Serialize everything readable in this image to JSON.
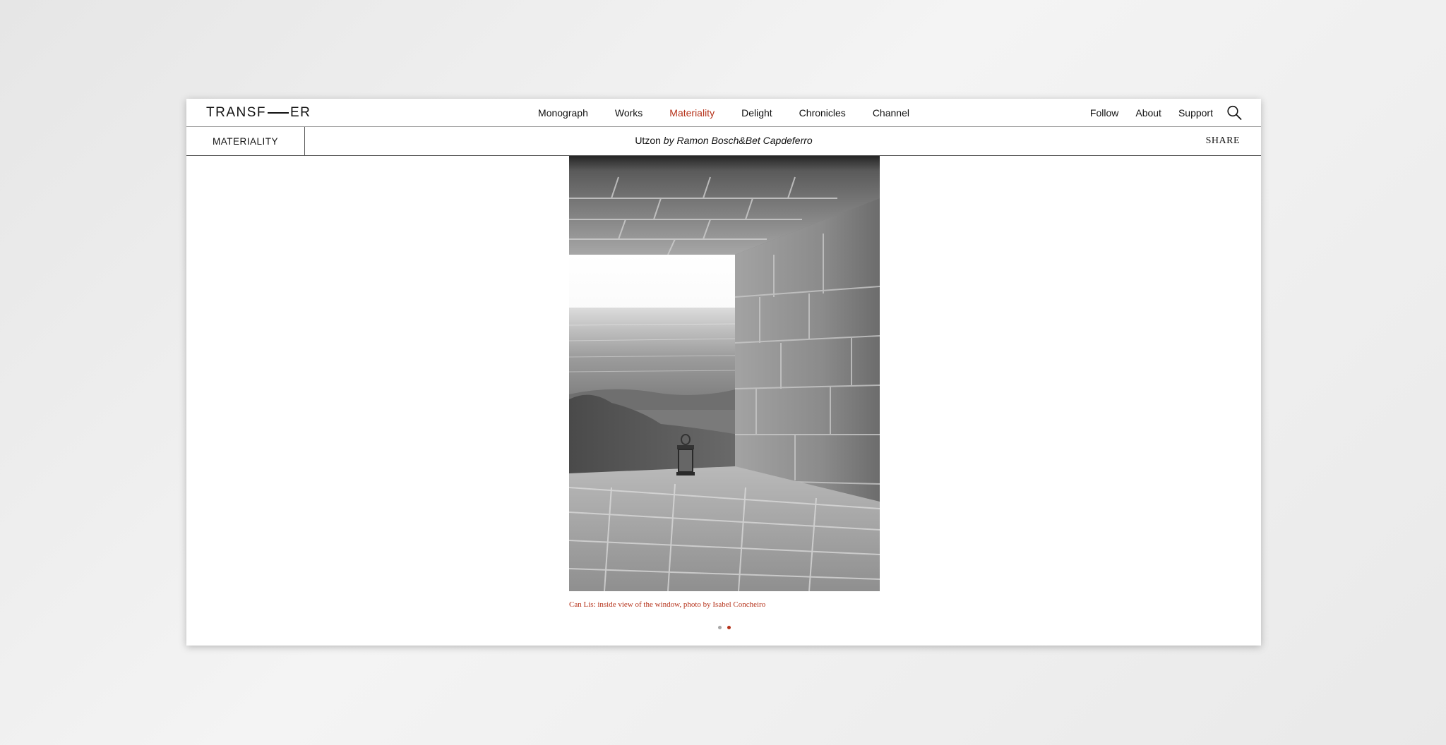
{
  "brand": {
    "logo_left": "TRANSF",
    "logo_right": "ER"
  },
  "nav": {
    "items": [
      {
        "label": "Monograph"
      },
      {
        "label": "Works"
      },
      {
        "label": "Materiality",
        "active": true
      },
      {
        "label": "Delight"
      },
      {
        "label": "Chronicles"
      },
      {
        "label": "Channel"
      }
    ],
    "right": [
      {
        "label": "Follow"
      },
      {
        "label": "About"
      },
      {
        "label": "Support"
      }
    ],
    "search_icon": "search-icon"
  },
  "subheader": {
    "section": "MATERIALITY",
    "title": "Utzon",
    "by": "by",
    "authors": "Ramon Bosch&Bet Capdeferro",
    "share": "SHARE"
  },
  "slideshow": {
    "caption": "Can Lis: inside view of the window, photo by Isabel Concheiro",
    "current": 2,
    "total": 2
  },
  "colors": {
    "accent": "#b53119",
    "text": "#111111",
    "divider": "#9a9a9a"
  }
}
